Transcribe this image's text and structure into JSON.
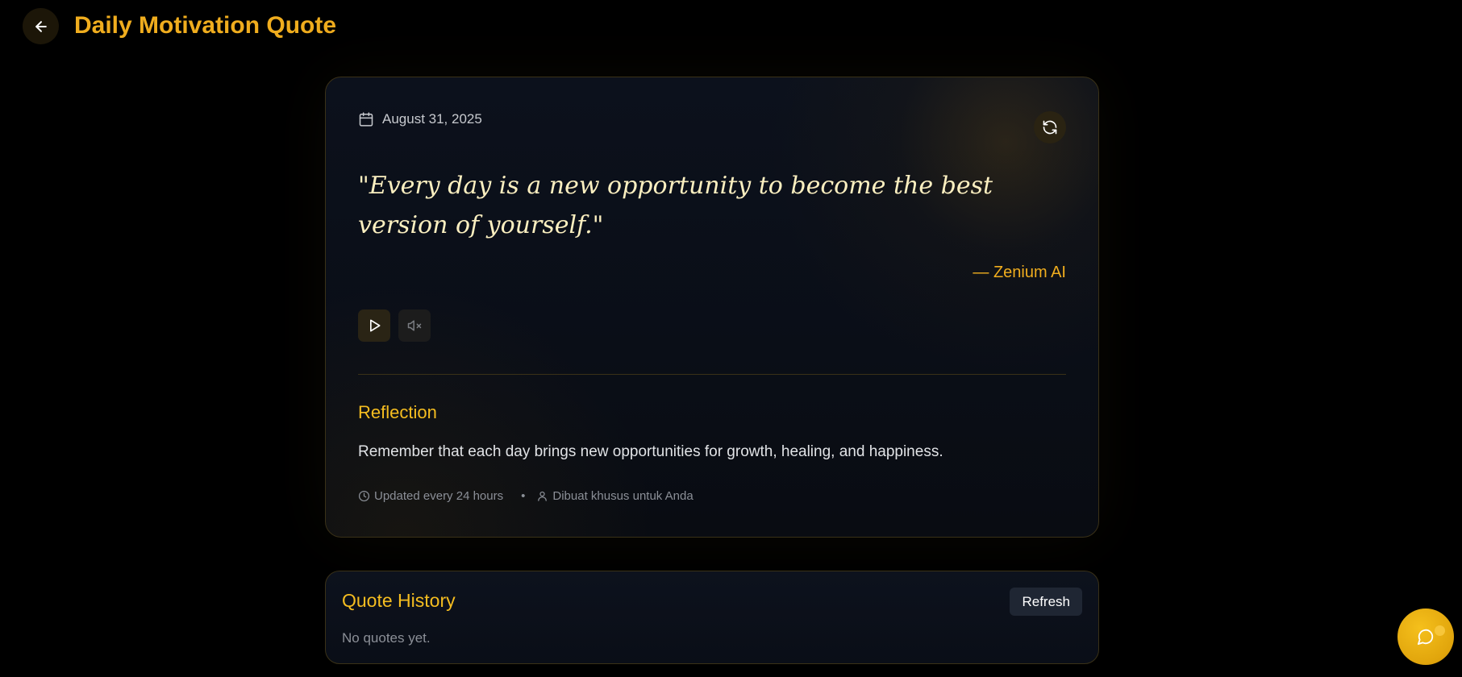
{
  "header": {
    "title": "Daily Motivation Quote"
  },
  "quote_card": {
    "date": "August 31, 2025",
    "quote": "\"Every day is a new opportunity to become the best version of yourself.\"",
    "author": "— Zenium AI",
    "reflection_title": "Reflection",
    "reflection_text": "Remember that each day brings new opportunities for growth, healing, and happiness.",
    "meta": {
      "updated": "Updated every 24 hours",
      "separator": "•",
      "personal": "Dibuat khusus untuk Anda"
    }
  },
  "history": {
    "title": "Quote History",
    "refresh_label": "Refresh",
    "empty_text": "No quotes yet."
  },
  "icons": {
    "back": "arrow-left-icon",
    "calendar": "calendar-icon",
    "refresh": "refresh-icon",
    "play": "play-icon",
    "mute": "volume-mute-icon",
    "clock": "clock-icon",
    "user": "user-icon",
    "chat": "chat-icon"
  },
  "colors": {
    "accent": "#f0ad1e",
    "quote_text": "#fbefc0",
    "background": "#000000"
  }
}
